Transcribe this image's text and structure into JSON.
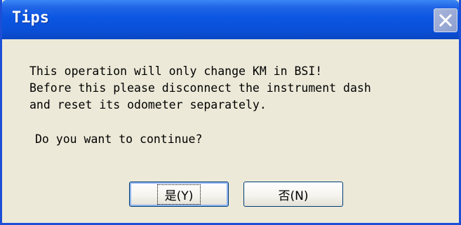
{
  "window": {
    "title": "Tips",
    "close_icon": "close-icon"
  },
  "message": {
    "line1": "This operation will only change KM in BSI!",
    "line2": "Before this please disconnect the instrument dash",
    "line3": "and reset its odometer separately.",
    "question": "Do you want to continue?"
  },
  "buttons": {
    "yes_label": "是(Y)",
    "no_label": "否(N)"
  },
  "colors": {
    "titlebar": "#0a4fd6",
    "background": "#ece9d8"
  }
}
